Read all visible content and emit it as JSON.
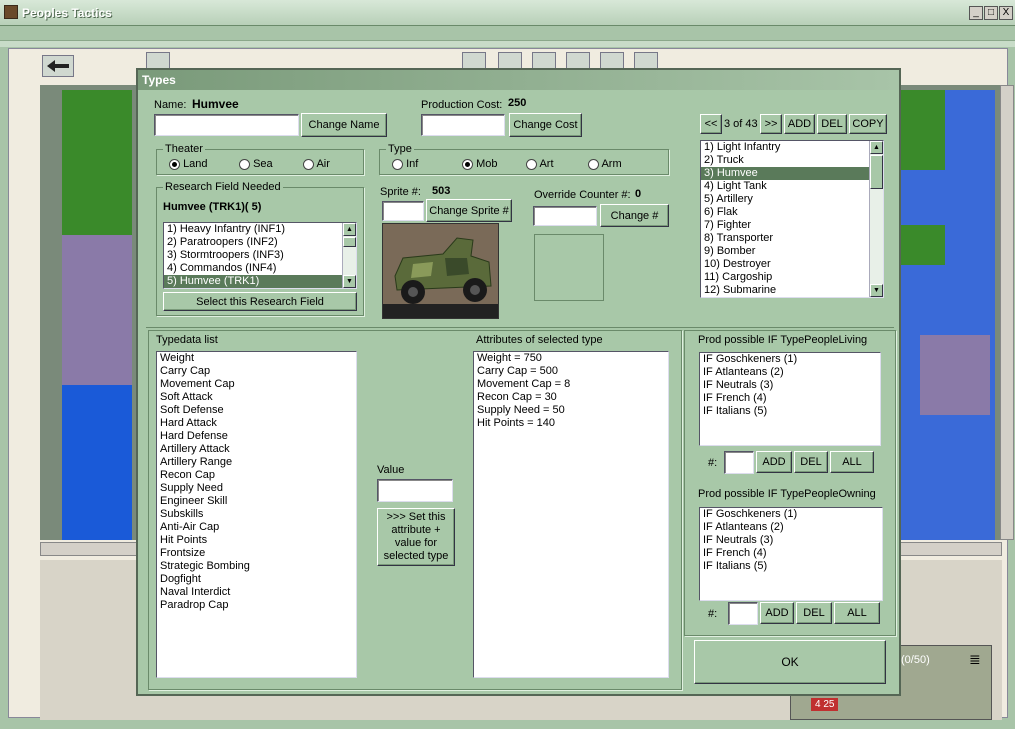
{
  "window": {
    "title": "Peoples Tactics",
    "min": "_",
    "max": "□",
    "close": "X"
  },
  "dialog": {
    "title": "Types",
    "name_label": "Name:",
    "name_value": "Humvee",
    "change_name": "Change Name",
    "prod_cost_label": "Production Cost:",
    "prod_cost_value": "250",
    "change_cost": "Change Cost",
    "nav": {
      "prev": "<<",
      "pos": "3 of 43",
      "next": ">>",
      "add": "ADD",
      "del": "DEL",
      "copy": "COPY"
    },
    "theater": {
      "title": "Theater",
      "options": [
        "Land",
        "Sea",
        "Air"
      ],
      "selected": "Land"
    },
    "type": {
      "title": "Type",
      "options": [
        "Inf",
        "Mob",
        "Art",
        "Arm"
      ],
      "selected": "Mob"
    },
    "research": {
      "title": "Research Field Needed",
      "current": "Humvee (TRK1)( 5)",
      "items": [
        "1) Heavy Infantry (INF1)",
        "2) Paratroopers (INF2)",
        "3) Stormtroopers (INF3)",
        "4) Commandos (INF4)",
        "5) Humvee (TRK1)"
      ],
      "selected_index": 4,
      "select_button": "Select this Research Field"
    },
    "sprite_label": "Sprite #:",
    "sprite_value": "503",
    "change_sprite": "Change Sprite #",
    "override_label": "Override Counter #:",
    "override_value": "0",
    "change_num": "Change #",
    "types_list": [
      "1) Light Infantry",
      "2) Truck",
      "3) Humvee",
      "4) Light Tank",
      "5) Artillery",
      "6) Flak",
      "7) Fighter",
      "8) Transporter",
      "9) Bomber",
      "10) Destroyer",
      "11) Cargoship",
      "12) Submarine"
    ],
    "types_selected_index": 2,
    "typedata_title": "Typedata list",
    "typedata": [
      "Weight",
      "Carry Cap",
      "Movement Cap",
      "Soft Attack",
      "Soft Defense",
      "Hard Attack",
      "Hard Defense",
      "Artillery Attack",
      "Artillery Range",
      "Recon Cap",
      "Supply Need",
      "Engineer Skill",
      "Subskills",
      "Anti-Air Cap",
      "Hit Points",
      "Frontsize",
      "Strategic Bombing",
      "Dogfight",
      "Naval Interdict",
      "Paradrop Cap"
    ],
    "value_label": "Value",
    "set_button": ">>> Set this attribute + value for selected type",
    "attributes_title": "Attributes of selected type",
    "attributes": [
      "Weight = 750",
      "Carry Cap = 500",
      "Movement Cap = 8",
      "Recon Cap = 30",
      "Supply Need = 50",
      "Hit Points = 140"
    ],
    "living": {
      "title": "Prod possible IF TypePeopleLiving",
      "items": [
        "IF Goschkeners (1)",
        "IF Atlanteans (2)",
        "IF Neutrals (3)",
        "IF French (4)",
        "IF Italians (5)"
      ],
      "num_label": "#:",
      "add": "ADD",
      "del": "DEL",
      "all": "ALL"
    },
    "owning": {
      "title": "Prod possible IF TypePeopleOwning",
      "items": [
        "IF Goschkeners (1)",
        "IF Atlanteans (2)",
        "IF Neutrals (3)",
        "IF French (4)",
        "IF Italians (5)"
      ],
      "num_label": "#:",
      "add": "ADD",
      "del": "DEL",
      "all": "ALL"
    },
    "ok": "OK"
  },
  "corner": {
    "counter": "(0/50)",
    "badge": "4 25"
  },
  "colors": {
    "dialog_bg": "#a8c8a8",
    "selection": "#5a7a5a"
  }
}
